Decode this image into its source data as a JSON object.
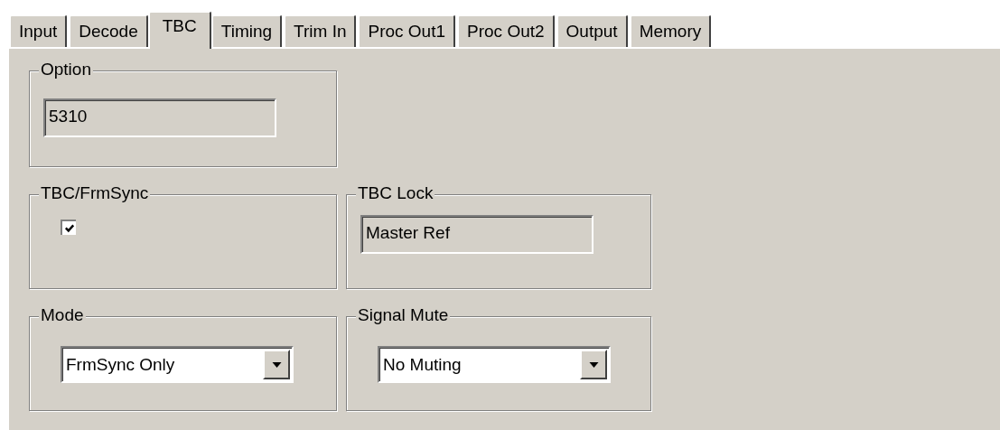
{
  "tabs": [
    {
      "label": "Input",
      "selected": false
    },
    {
      "label": "Decode",
      "selected": false
    },
    {
      "label": "TBC",
      "selected": true
    },
    {
      "label": "Timing",
      "selected": false
    },
    {
      "label": "Trim In",
      "selected": false
    },
    {
      "label": "Proc Out1",
      "selected": false
    },
    {
      "label": "Proc Out2",
      "selected": false
    },
    {
      "label": "Output",
      "selected": false
    },
    {
      "label": "Memory",
      "selected": false
    }
  ],
  "groups": [
    {
      "title": "Option",
      "kind": "text-field",
      "value": "5310"
    },
    {
      "title": "TBC/FrmSync",
      "kind": "checkbox",
      "checked": true
    },
    {
      "title": "TBC Lock",
      "kind": "text-field",
      "value": "Master Ref"
    },
    {
      "title": "Mode",
      "kind": "dropdown",
      "value": "FrmSync Only"
    },
    {
      "title": "Signal Mute",
      "kind": "dropdown",
      "value": "No Muting"
    }
  ]
}
